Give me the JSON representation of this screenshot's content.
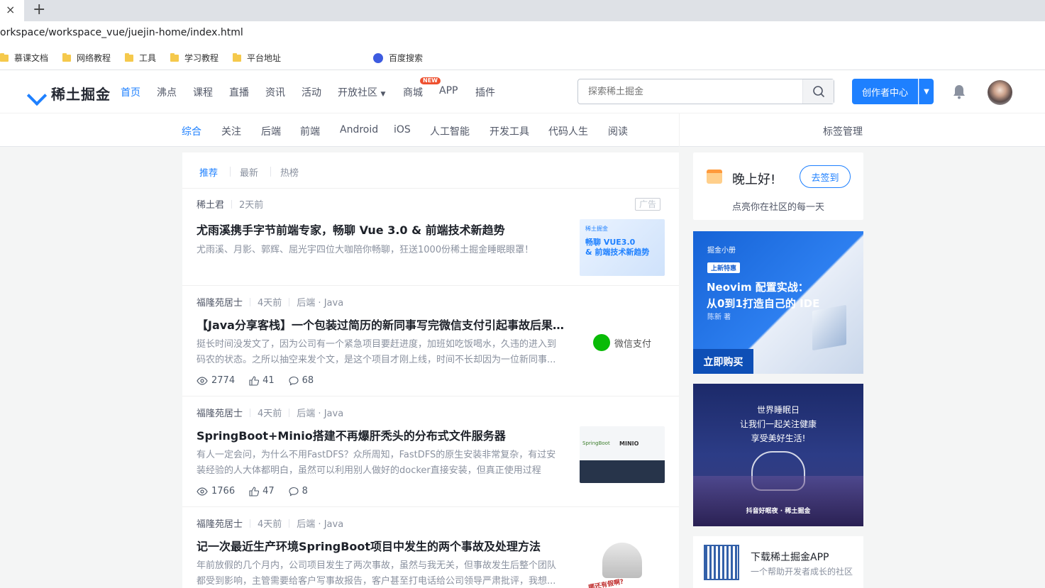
{
  "browser": {
    "tab_close": "×",
    "new_tab": "+",
    "url": "orkspace/workspace_vue/juejin-home/index.html",
    "bookmarks": [
      {
        "label": "慕课文档",
        "icon": "folder-icon"
      },
      {
        "label": "网络教程",
        "icon": "folder-icon"
      },
      {
        "label": "工具",
        "icon": "folder-icon"
      },
      {
        "label": "学习教程",
        "icon": "folder-icon"
      },
      {
        "label": "平台地址",
        "icon": "folder-icon"
      },
      {
        "label": "百度搜索",
        "icon": "baidu-icon"
      }
    ]
  },
  "header": {
    "logo_text": "稀土掘金",
    "nav": [
      "首页",
      "沸点",
      "课程",
      "直播",
      "资讯",
      "活动",
      "开放社区",
      "商城",
      "APP",
      "插件"
    ],
    "new_badge": "NEW",
    "search_placeholder": "探索稀土掘金",
    "create_label": "创作者中心"
  },
  "subnav": {
    "items": [
      "综合",
      "关注",
      "后端",
      "前端",
      "Android",
      "iOS",
      "人工智能",
      "开发工具",
      "代码人生",
      "阅读"
    ],
    "manage": "标签管理"
  },
  "feed": {
    "tabs": [
      "推荐",
      "最新",
      "热榜"
    ],
    "ad_tag": "广告",
    "items": [
      {
        "author": "稀土君",
        "time": "2天前",
        "tags": "",
        "title": "尤雨溪携手字节前端专家，畅聊 Vue 3.0 & 前端技术新趋势",
        "abstract": "尤雨溪、月影、郭辉、屈光宇四位大咖陪你畅聊，狂送1000份稀土掘金睡眠眼罩！",
        "thumb_text": [
          "稀土掘金",
          "畅聊 VUE3.0",
          "& 前端技术新趋势"
        ]
      },
      {
        "author": "福隆苑居士",
        "time": "4天前",
        "tags": "后端 · Java",
        "title": "【Java分享客栈】一个包装过简历的新同事写完微信支付引起事故后果...",
        "abstract": "挺长时间没发文了，因为公司有一个紧急项目要赶进度，加班如吃饭喝水，久违的进入到码农的状态。之所以抽空来发个文，是这个项目才刚上线，时间不长却因为一位新同事...",
        "views": "2774",
        "likes": "41",
        "comments": "68",
        "thumb_text": [
          "微信支付"
        ]
      },
      {
        "author": "福隆苑居士",
        "time": "4天前",
        "tags": "后端 · Java",
        "title": "SpringBoot+Minio搭建不再爆肝秃头的分布式文件服务器",
        "abstract": "有人一定会问，为什么不用FastDFS？众所周知，FastDFS的原生安装非常复杂，有过安装经验的人大体都明白，虽然可以利用别人做好的docker直接安装，但真正使用过程中...",
        "views": "1766",
        "likes": "47",
        "comments": "8",
        "thumb_text": [
          "SpringBoot",
          "MINIO"
        ]
      },
      {
        "author": "福隆苑居士",
        "time": "4天前",
        "tags": "后端 · Java",
        "title": "记一次最近生产环境SpringBoot项目中发生的两个事故及处理方法",
        "abstract": "年前放假的几个月内，公司项目发生了两次事故，虽然与我无关，但事故发生后整个团队都受到影响，主管需要给客户写事故报告，客户甚至打电话给公司领导严肃批评，我想...",
        "thumb_text": [
          "哪还有假啊?"
        ]
      }
    ]
  },
  "sidebar": {
    "greeting": "晚上好!",
    "checkin": "去签到",
    "signin_sub": "点亮你在社区的每一天",
    "banner1": {
      "brand": "掘金小册",
      "tag": "上新特惠",
      "title1": "Neovim 配置实战：",
      "title2": "从0到1打造自己的 IDE",
      "author": "陈新 著",
      "buy": "立即购买"
    },
    "banner2": {
      "line1": "世界睡眠日",
      "line2": "让我们一起关注健康",
      "line3": "享受美好生活!",
      "footer": "抖音好眠夜 · 稀土掘金"
    },
    "app_title": "下载稀土掘金APP",
    "app_sub": "一个帮助开发者成长的社区"
  },
  "colors": {
    "accent": "#1e80ff",
    "ad_badge": "#ee502f"
  }
}
